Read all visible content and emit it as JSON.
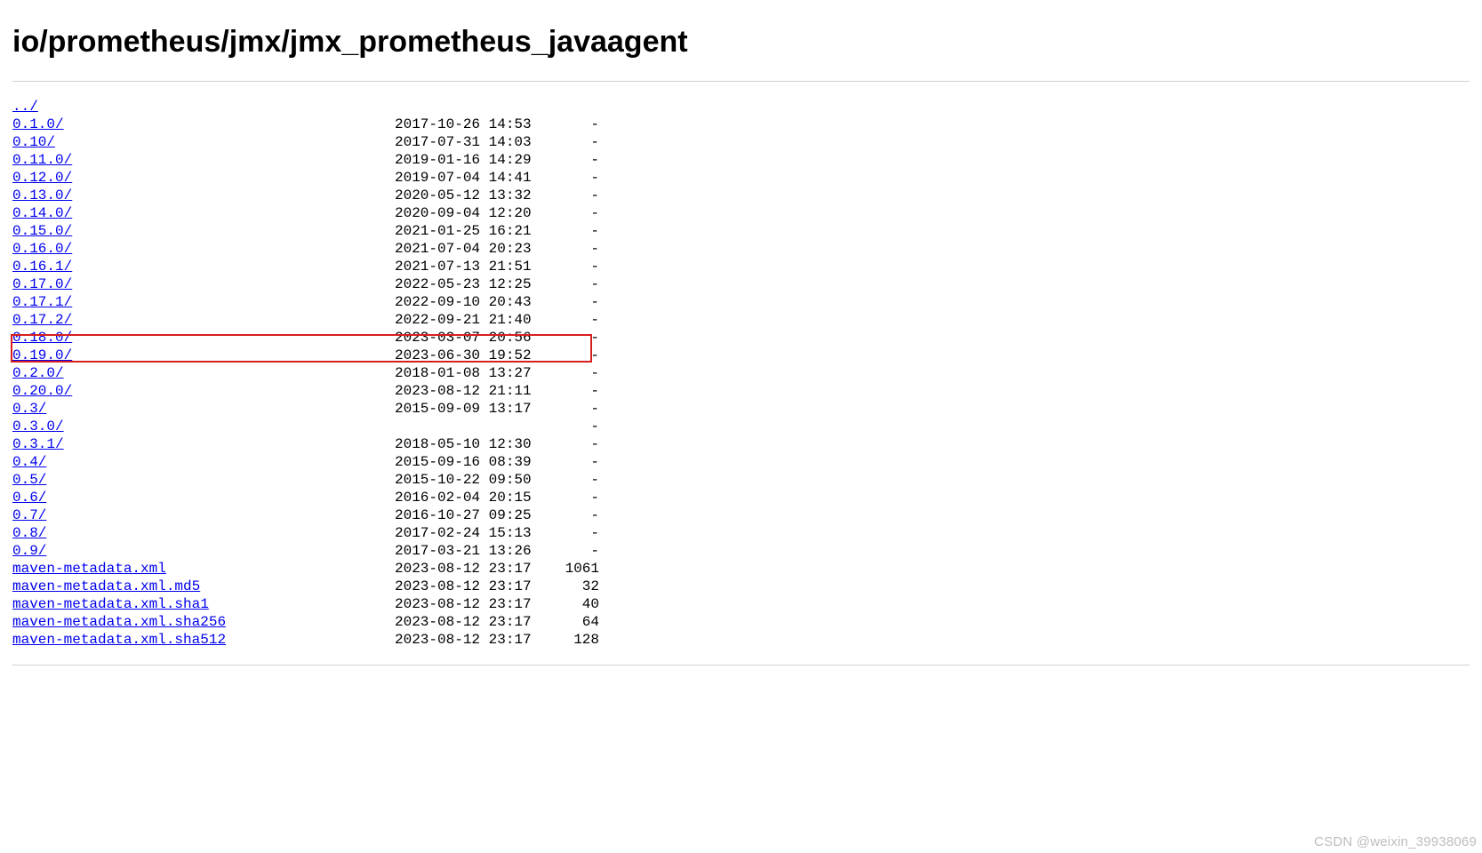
{
  "title": "io/prometheus/jmx/jmx_prometheus_javaagent",
  "parent_link": "../",
  "entries": [
    {
      "name": "0.1.0/",
      "date": "2017-10-26 14:53",
      "size": "-"
    },
    {
      "name": "0.10/",
      "date": "2017-07-31 14:03",
      "size": "-"
    },
    {
      "name": "0.11.0/",
      "date": "2019-01-16 14:29",
      "size": "-"
    },
    {
      "name": "0.12.0/",
      "date": "2019-07-04 14:41",
      "size": "-"
    },
    {
      "name": "0.13.0/",
      "date": "2020-05-12 13:32",
      "size": "-"
    },
    {
      "name": "0.14.0/",
      "date": "2020-09-04 12:20",
      "size": "-"
    },
    {
      "name": "0.15.0/",
      "date": "2021-01-25 16:21",
      "size": "-"
    },
    {
      "name": "0.16.0/",
      "date": "2021-07-04 20:23",
      "size": "-"
    },
    {
      "name": "0.16.1/",
      "date": "2021-07-13 21:51",
      "size": "-"
    },
    {
      "name": "0.17.0/",
      "date": "2022-05-23 12:25",
      "size": "-"
    },
    {
      "name": "0.17.1/",
      "date": "2022-09-10 20:43",
      "size": "-"
    },
    {
      "name": "0.17.2/",
      "date": "2022-09-21 21:40",
      "size": "-"
    },
    {
      "name": "0.18.0/",
      "date": "2023-03-07 20:56",
      "size": "-"
    },
    {
      "name": "0.19.0/",
      "date": "2023-06-30 19:52",
      "size": "-",
      "highlighted": true
    },
    {
      "name": "0.2.0/",
      "date": "2018-01-08 13:27",
      "size": "-"
    },
    {
      "name": "0.20.0/",
      "date": "2023-08-12 21:11",
      "size": "-"
    },
    {
      "name": "0.3/",
      "date": "2015-09-09 13:17",
      "size": "-"
    },
    {
      "name": "0.3.0/",
      "date": "-",
      "size": "-"
    },
    {
      "name": "0.3.1/",
      "date": "2018-05-10 12:30",
      "size": "-"
    },
    {
      "name": "0.4/",
      "date": "2015-09-16 08:39",
      "size": "-"
    },
    {
      "name": "0.5/",
      "date": "2015-10-22 09:50",
      "size": "-"
    },
    {
      "name": "0.6/",
      "date": "2016-02-04 20:15",
      "size": "-"
    },
    {
      "name": "0.7/",
      "date": "2016-10-27 09:25",
      "size": "-"
    },
    {
      "name": "0.8/",
      "date": "2017-02-24 15:13",
      "size": "-"
    },
    {
      "name": "0.9/",
      "date": "2017-03-21 13:26",
      "size": "-"
    },
    {
      "name": "maven-metadata.xml",
      "date": "2023-08-12 23:17",
      "size": "1061"
    },
    {
      "name": "maven-metadata.xml.md5",
      "date": "2023-08-12 23:17",
      "size": "32"
    },
    {
      "name": "maven-metadata.xml.sha1",
      "date": "2023-08-12 23:17",
      "size": "40"
    },
    {
      "name": "maven-metadata.xml.sha256",
      "date": "2023-08-12 23:17",
      "size": "64"
    },
    {
      "name": "maven-metadata.xml.sha512",
      "date": "2023-08-12 23:17",
      "size": "128"
    }
  ],
  "highlight_row_index": 13,
  "watermark": "CSDN @weixin_39938069"
}
